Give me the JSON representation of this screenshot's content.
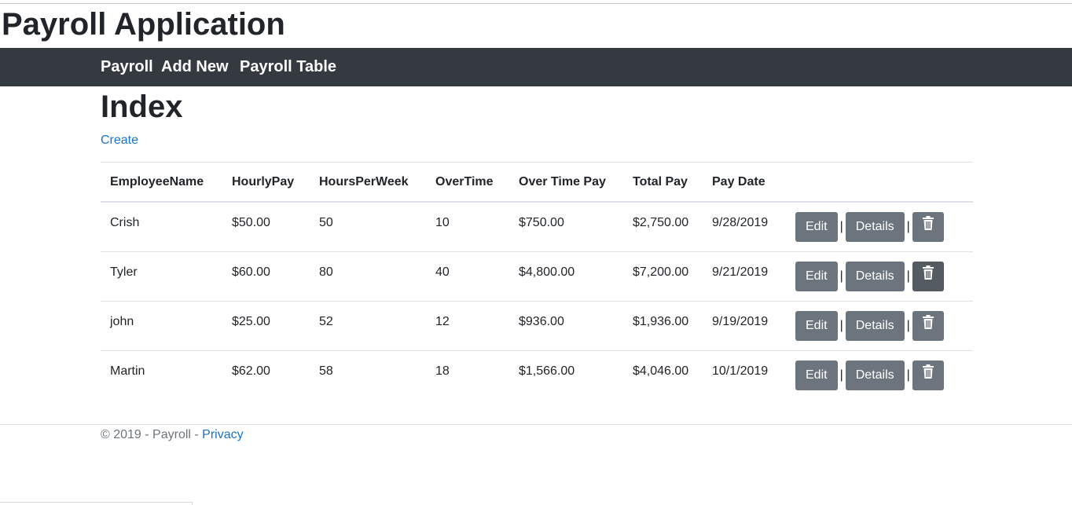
{
  "app": {
    "title": "Payroll Application"
  },
  "nav": {
    "items": [
      {
        "label": "Payroll"
      },
      {
        "label": "Add New"
      },
      {
        "label": "Payroll Table"
      }
    ]
  },
  "page": {
    "heading": "Index",
    "create_link": "Create"
  },
  "table": {
    "columns": [
      "EmployeeName",
      "HourlyPay",
      "HoursPerWeek",
      "OverTime",
      "Over Time Pay",
      "Total Pay",
      "Pay Date"
    ],
    "rows": [
      [
        "Crish",
        "$50.00",
        "50",
        "10",
        "$750.00",
        "$2,750.00",
        "9/28/2019"
      ],
      [
        "Tyler",
        "$60.00",
        "80",
        "40",
        "$4,800.00",
        "$7,200.00",
        "9/21/2019"
      ],
      [
        "john",
        "$25.00",
        "52",
        "12",
        "$936.00",
        "$1,936.00",
        "9/19/2019"
      ],
      [
        "Martin",
        "$62.00",
        "58",
        "18",
        "$1,566.00",
        "$4,046.00",
        "10/1/2019"
      ]
    ],
    "actions": {
      "edit_label": "Edit",
      "details_label": "Details",
      "separator": "|",
      "delete_icon": "trash-icon"
    }
  },
  "footer": {
    "text": "© 2019 - Payroll - ",
    "privacy_link": "Privacy"
  },
  "colors": {
    "navbar": "#343a40",
    "button": "#6c757d",
    "button_active": "#545b62",
    "link": "#1a73c8"
  }
}
